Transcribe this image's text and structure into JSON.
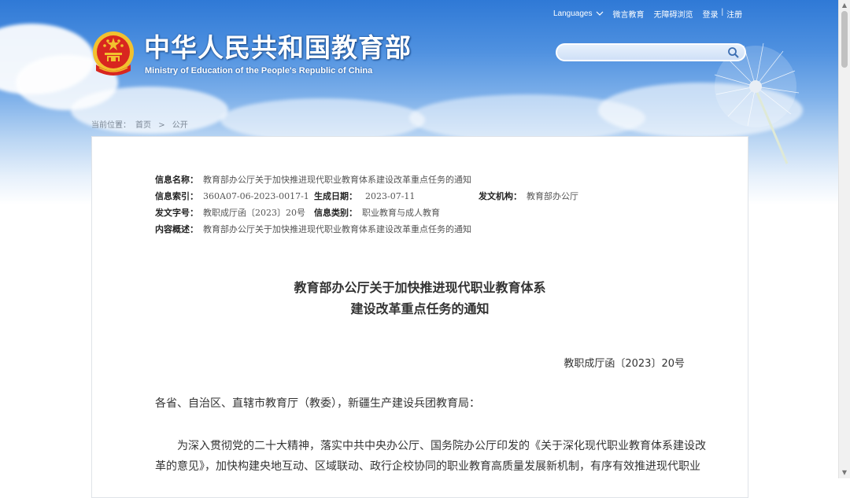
{
  "header": {
    "nav": {
      "languages": "Languages",
      "weibo": "微言教育",
      "accessibility": "无障碍浏览",
      "login": "登录",
      "separator": "|",
      "register": "注册"
    },
    "site_title": "中华人民共和国教育部",
    "site_subtitle": "Ministry of Education of the People's Republic of China",
    "search": {
      "placeholder": ""
    }
  },
  "breadcrumb": {
    "prefix": "当前位置：",
    "home": "首页",
    "arrow": ">",
    "current": "公开"
  },
  "info": {
    "name_label": "信息名称：",
    "name_value": "教育部办公厅关于加快推进现代职业教育体系建设改革重点任务的通知",
    "index_label": "信息索引：",
    "index_value": "360A07-06-2023-0017-1",
    "date_label": "生成日期：",
    "date_value": "2023-07-11",
    "issuer_label": "发文机构：",
    "issuer_value": "教育部办公厅",
    "docno_label": "发文字号：",
    "docno_value": "教职成厅函〔2023〕20号",
    "category_label": "信息类别：",
    "category_value": "职业教育与成人教育",
    "summary_label": "内容概述：",
    "summary_value": "教育部办公厅关于加快推进现代职业教育体系建设改革重点任务的通知"
  },
  "document": {
    "title_line1": "教育部办公厅关于加快推进现代职业教育体系",
    "title_line2": "建设改革重点任务的通知",
    "number": "教职成厅函〔2023〕20号",
    "salutation": "各省、自治区、直辖市教育厅（教委），新疆生产建设兵团教育局：",
    "para1_line1": "为深入贯彻党的二十大精神，落实中共中央办公厅、国务院办公厅印发的《关于深化现代职业教育体系建设改",
    "para1_line2": "革的意见》，加快构建央地互动、区域联动、政行企校协同的职业教育高质量发展新机制，有序有效推进现代职业"
  },
  "colors": {
    "sky_top": "#2f79d6",
    "title_shadow": "#1a4f95",
    "emblem_red": "#d8261f",
    "emblem_gold": "#f2c12e"
  }
}
